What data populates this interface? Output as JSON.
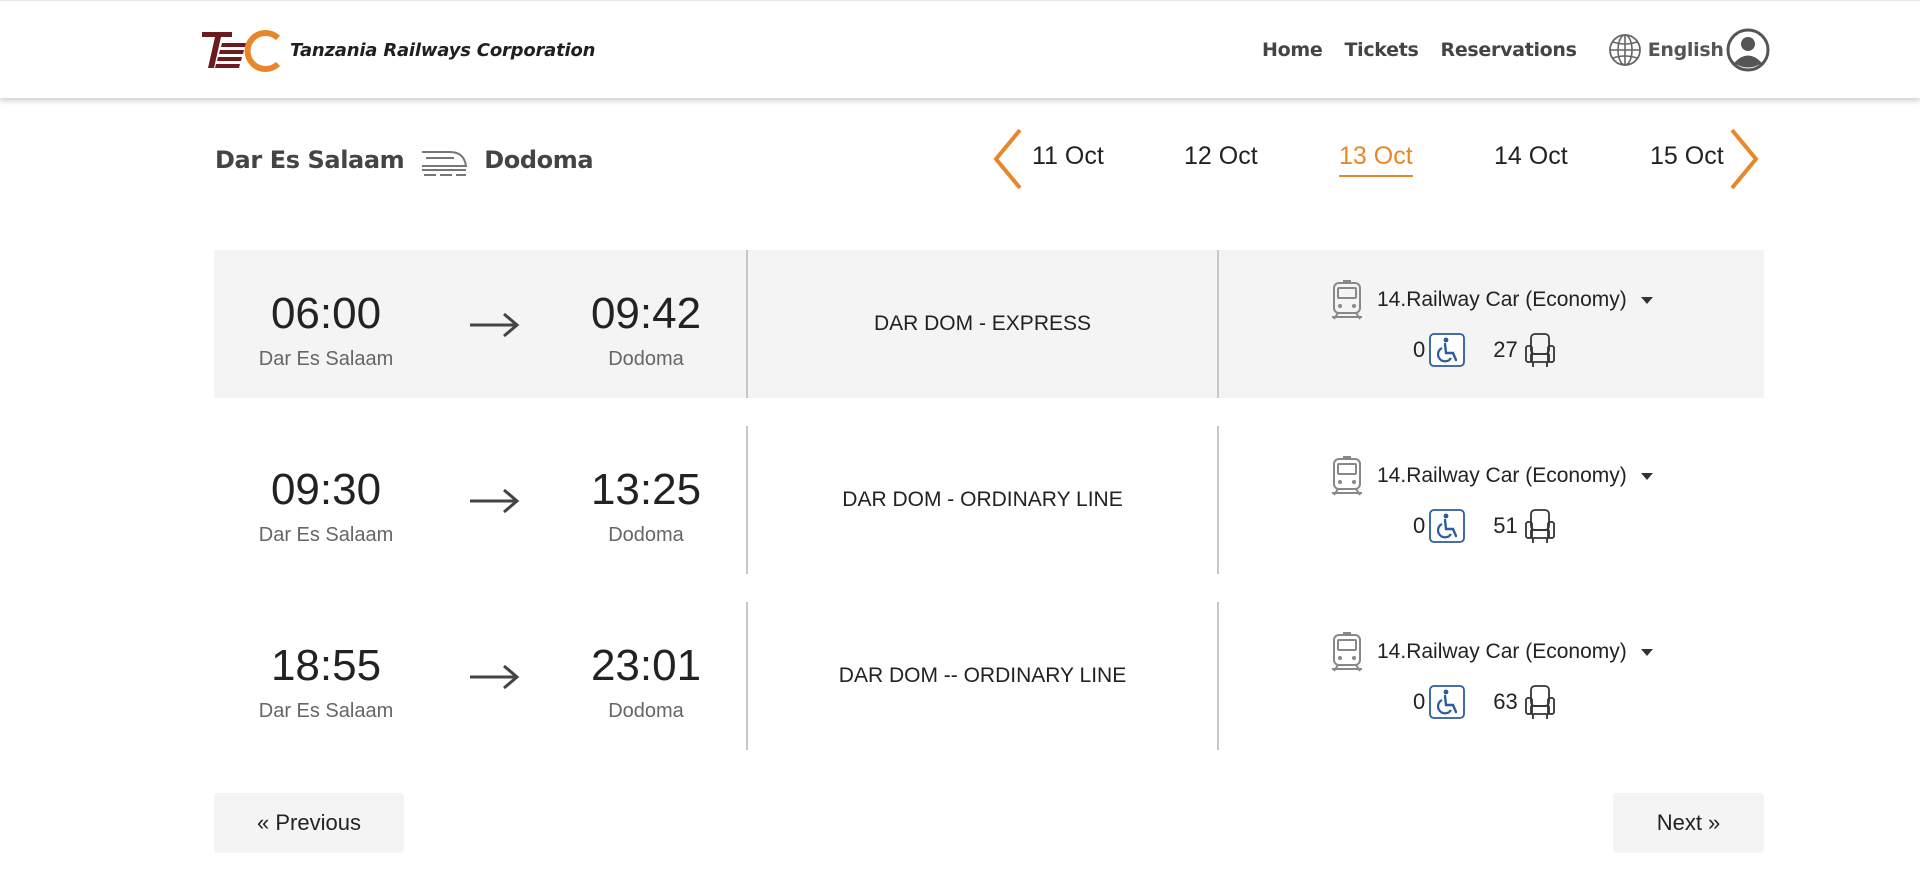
{
  "brand": {
    "name": "Tanzania Railways Corporation",
    "colors": {
      "accent": "#e8872a",
      "logo_dark": "#6b1a1f",
      "icon_blue": "#2a5c9e"
    }
  },
  "nav": {
    "items": [
      "Home",
      "Tickets",
      "Reservations"
    ],
    "language": "English",
    "globe_icon": "globe-icon",
    "profile_icon": "user-avatar-icon"
  },
  "route": {
    "origin": "Dar Es Salaam",
    "destination": "Dodoma",
    "icon": "train-icon"
  },
  "dates": {
    "items": [
      "11 Oct",
      "12 Oct",
      "13 Oct",
      "14 Oct",
      "15 Oct"
    ],
    "selected": "13 Oct"
  },
  "trips": [
    {
      "departure_time": "06:00",
      "departure_station": "Dar Es Salaam",
      "arrival_time": "09:42",
      "arrival_station": "Dodoma",
      "train_name": "DAR DOM - EXPRESS",
      "car_class": "14.Railway Car (Economy)",
      "accessible_seats": "0",
      "regular_seats": "27"
    },
    {
      "departure_time": "09:30",
      "departure_station": "Dar Es Salaam",
      "arrival_time": "13:25",
      "arrival_station": "Dodoma",
      "train_name": "DAR DOM - ORDINARY LINE",
      "car_class": "14.Railway Car (Economy)",
      "accessible_seats": "0",
      "regular_seats": "51"
    },
    {
      "departure_time": "18:55",
      "departure_station": "Dar Es Salaam",
      "arrival_time": "23:01",
      "arrival_station": "Dodoma",
      "train_name": "DAR DOM -- ORDINARY LINE",
      "car_class": "14.Railway Car (Economy)",
      "accessible_seats": "0",
      "regular_seats": "63"
    }
  ],
  "pagination": {
    "previous_label": "« Previous",
    "next_label": "Next »"
  }
}
